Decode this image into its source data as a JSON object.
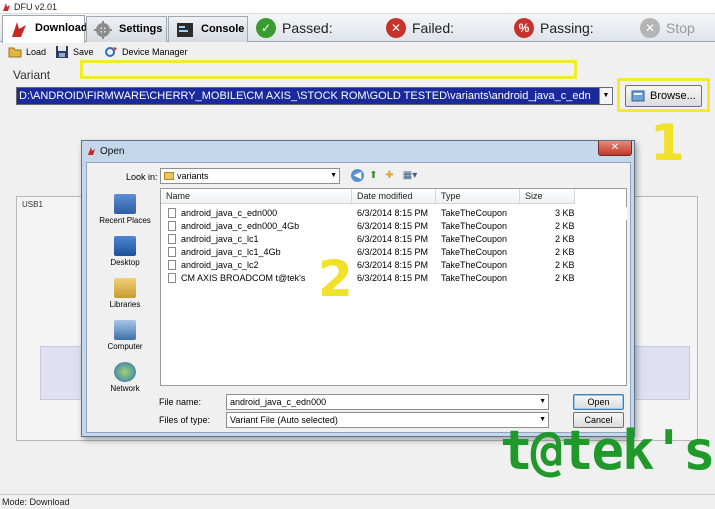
{
  "window": {
    "title": "DFU v2.01"
  },
  "tabs": [
    {
      "label": "Download",
      "icon": "download-arrow-icon"
    },
    {
      "label": "Settings",
      "icon": "gear-icon"
    },
    {
      "label": "Console",
      "icon": "console-icon"
    }
  ],
  "status": {
    "passed": "Passed:",
    "failed": "Failed:",
    "passing": "Passing:",
    "stop": "Stop",
    "colors": {
      "passed": "#3a9b2e",
      "failed": "#c8322a",
      "passing": "#c8322a",
      "stop": "#b4b4b4"
    }
  },
  "toolbar": {
    "load": "Load",
    "save": "Save",
    "device_manager": "Device Manager"
  },
  "variant": {
    "label": "Variant",
    "path": "D:\\ANDROID\\FIRMWARE\\CHERRY_MOBILE\\CM AXIS_\\STOCK ROM\\GOLD TESTED\\variants\\android_java_c_edn",
    "browse": "Browse..."
  },
  "annotations": {
    "step1": "1",
    "step2": "2"
  },
  "usb": {
    "label": "USB1"
  },
  "statusbar": {
    "mode": "Mode: Download"
  },
  "watermark": "t@tek's",
  "dialog": {
    "title": "Open",
    "look_in_label": "Look in:",
    "look_in_value": "variants",
    "places": [
      "Recent Places",
      "Desktop",
      "Libraries",
      "Computer",
      "Network"
    ],
    "columns": [
      "Name",
      "Date modified",
      "Type",
      "Size"
    ],
    "files": [
      {
        "name": "android_java_c_edn000",
        "date": "6/3/2014 8:15 PM",
        "type": "TakeTheCoupon",
        "size": "3 KB"
      },
      {
        "name": "android_java_c_edn000_4Gb",
        "date": "6/3/2014 8:15 PM",
        "type": "TakeTheCoupon",
        "size": "2 KB"
      },
      {
        "name": "android_java_c_lc1",
        "date": "6/3/2014 8:15 PM",
        "type": "TakeTheCoupon",
        "size": "2 KB"
      },
      {
        "name": "android_java_c_lc1_4Gb",
        "date": "6/3/2014 8:15 PM",
        "type": "TakeTheCoupon",
        "size": "2 KB"
      },
      {
        "name": "android_java_c_lc2",
        "date": "6/3/2014 8:15 PM",
        "type": "TakeTheCoupon",
        "size": "2 KB"
      },
      {
        "name": "CM AXIS BROADCOM t@tek's",
        "date": "6/3/2014 8:15 PM",
        "type": "TakeTheCoupon",
        "size": "2 KB"
      }
    ],
    "file_name_label": "File name:",
    "file_name_value": "android_java_c_edn000",
    "file_type_label": "Files of type:",
    "file_type_value": "Variant File (Auto selected)",
    "open_button": "Open",
    "cancel_button": "Cancel"
  }
}
